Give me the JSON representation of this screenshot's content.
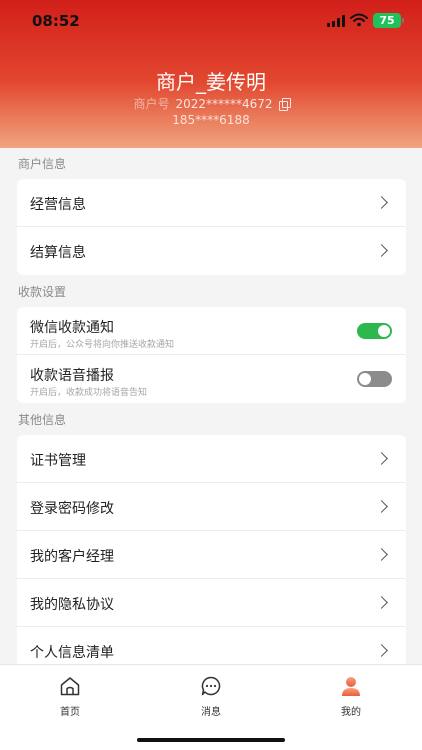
{
  "status": {
    "time": "08:52",
    "battery": "75"
  },
  "header": {
    "merchant_name": "商户_姜传明",
    "merchant_no_label": "商户号",
    "merchant_no": "2022******4672",
    "phone": "185****6188",
    "gradient": [
      "#d21f1a",
      "#f0a57f"
    ]
  },
  "sections": {
    "merchant_info": {
      "title": "商户信息",
      "items": [
        {
          "label": "经营信息"
        },
        {
          "label": "结算信息"
        }
      ]
    },
    "payment_settings": {
      "title": "收款设置",
      "items": [
        {
          "label": "微信收款通知",
          "sub": "开启后，公众号将向你推送收款通知",
          "enabled": true
        },
        {
          "label": "收款语音播报",
          "sub": "开启后，收款成功将语音告知",
          "enabled": false
        }
      ]
    },
    "other_info": {
      "title": "其他信息",
      "items": [
        {
          "label": "证书管理"
        },
        {
          "label": "登录密码修改"
        },
        {
          "label": "我的客户经理"
        },
        {
          "label": "我的隐私协议"
        },
        {
          "label": "个人信息清单"
        }
      ]
    }
  },
  "tabbar": {
    "items": [
      {
        "label": "首页",
        "icon": "home-icon"
      },
      {
        "label": "消息",
        "icon": "message-icon"
      },
      {
        "label": "我的",
        "icon": "profile-icon",
        "active": true
      }
    ],
    "active_color": "#f07a55"
  }
}
